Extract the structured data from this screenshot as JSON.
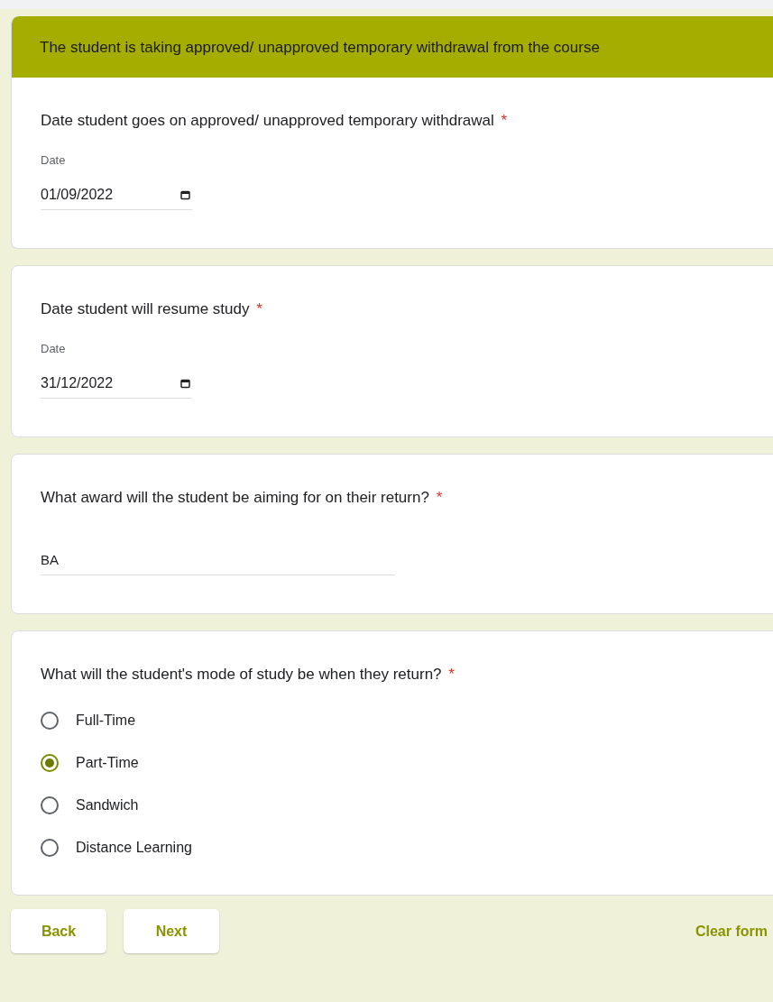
{
  "section_title": "The student is taking approved/ unapproved temporary withdrawal from the course",
  "questions": [
    {
      "kind": "date",
      "title": "Date student goes on approved/ unapproved temporary withdrawal",
      "required_mark": "*",
      "field_label": "Date",
      "value": "01/09/2022"
    },
    {
      "kind": "date",
      "title": "Date student will resume study",
      "required_mark": "*",
      "field_label": "Date",
      "value": "31/12/2022"
    },
    {
      "kind": "text",
      "title": "What award will the student be aiming for on their return?",
      "required_mark": "*",
      "value": "BA"
    },
    {
      "kind": "radio",
      "title": "What will the student's mode of study be when they return?",
      "required_mark": "*",
      "options": [
        {
          "label": "Full-Time",
          "selected": false
        },
        {
          "label": "Part-Time",
          "selected": true
        },
        {
          "label": "Sandwich",
          "selected": false
        },
        {
          "label": "Distance Learning",
          "selected": false
        }
      ]
    }
  ],
  "buttons": [
    {
      "label": "Back"
    },
    {
      "label": "Next"
    }
  ],
  "clear_form": "Clear form"
}
